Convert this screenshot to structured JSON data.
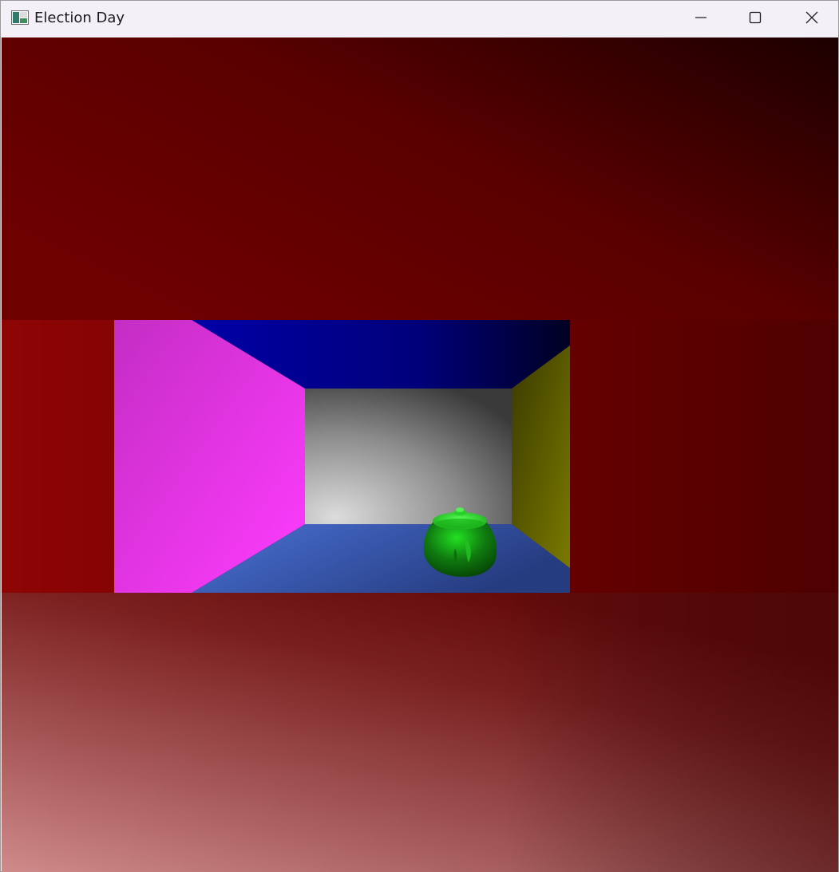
{
  "window": {
    "title": "Election Day",
    "app_icon": "window-app-icon",
    "controls": {
      "minimize_icon": "minimize-icon",
      "maximize_icon": "maximize-icon",
      "close_icon": "close-icon"
    }
  },
  "scene": {
    "description_object": "teapot",
    "colors": {
      "backdrop_dark": "#1c0000",
      "backdrop_red": "#8b0000",
      "left_wall": "#ff33ff",
      "ceiling": "#000099",
      "back_wall": "#d9d9d9",
      "right_wall": "#6b6b00",
      "floor": "#3f64c4",
      "teapot": "#11a011",
      "ground_highlight": "#cc8888"
    }
  }
}
